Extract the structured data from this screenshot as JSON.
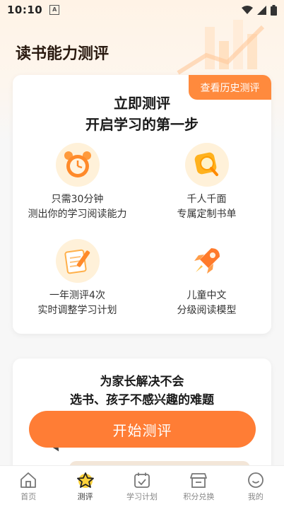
{
  "status": {
    "time": "10:10",
    "badge": "A"
  },
  "page_title": "读书能力测评",
  "card1": {
    "history_button": "查看历史测评",
    "title_line1": "立即测评",
    "title_line2": "开启学习的第一步",
    "features": [
      {
        "icon": "alarm-clock-icon",
        "line1": "只需30分钟",
        "line2": "测出你的学习阅读能力"
      },
      {
        "icon": "magnifier-icon",
        "line1": "千人千面",
        "line2": "专属定制书单"
      },
      {
        "icon": "notebook-pencil-icon",
        "line1": "一年测评4次",
        "line2": "实时调整学习计划"
      },
      {
        "icon": "rocket-icon",
        "line1": "儿童中文",
        "line2": "分级阅读模型"
      }
    ]
  },
  "card2": {
    "line1": "为家长解决不会",
    "line2": "选书、孩子不感兴趣的难题"
  },
  "start_button": "开始测评",
  "tabs": [
    {
      "label": "首页",
      "icon": "home-icon",
      "active": false
    },
    {
      "label": "测评",
      "icon": "star-icon",
      "active": true
    },
    {
      "label": "学习计划",
      "icon": "calendar-check-icon",
      "active": false
    },
    {
      "label": "积分兑换",
      "icon": "shop-icon",
      "active": false
    },
    {
      "label": "我的",
      "icon": "smiley-icon",
      "active": false
    }
  ],
  "colors": {
    "accent": "#ff7d35",
    "history_btn": "#ff8a3d",
    "icon_bg": "#fff1d9"
  }
}
